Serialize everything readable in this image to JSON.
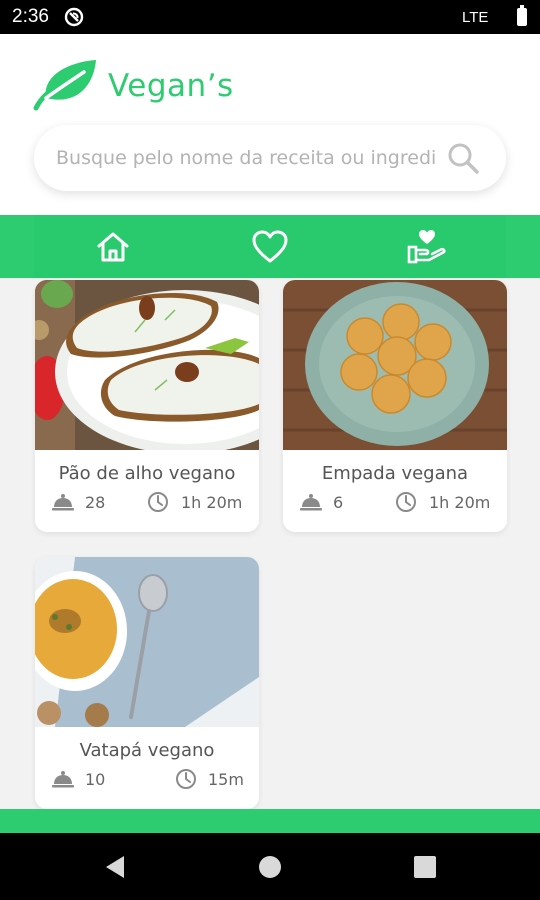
{
  "status_bar": {
    "time": "2:36",
    "network": "LTE",
    "dnd_icon": "do-not-disturb-icon",
    "battery_icon": "battery-icon"
  },
  "app": {
    "title": "Vegan’s",
    "logo_icon": "leaf-icon",
    "accent_color": "#2ecc71"
  },
  "search": {
    "placeholder": "Busque pelo nome da receita ou ingrediente",
    "value": "",
    "icon": "search-icon"
  },
  "tabs": [
    {
      "name": "home",
      "icon": "home-icon",
      "active": true
    },
    {
      "name": "favorites",
      "icon": "heart-icon",
      "active": false
    },
    {
      "name": "donate",
      "icon": "hand-heart-icon",
      "active": false
    }
  ],
  "recipes": [
    {
      "title": "Pão de alho vegano",
      "servings": "28",
      "time": "1h 20m",
      "servings_icon": "cloche-icon",
      "time_icon": "clock-icon"
    },
    {
      "title": "Empada vegana",
      "servings": "6",
      "time": "1h 20m",
      "servings_icon": "cloche-icon",
      "time_icon": "clock-icon"
    },
    {
      "title": "Vatapá vegano",
      "servings": "10",
      "time": "15m",
      "servings_icon": "cloche-icon",
      "time_icon": "clock-icon"
    }
  ],
  "nav_bar": {
    "back_icon": "back-triangle-icon",
    "home_icon": "home-circle-icon",
    "recents_icon": "recents-square-icon"
  }
}
